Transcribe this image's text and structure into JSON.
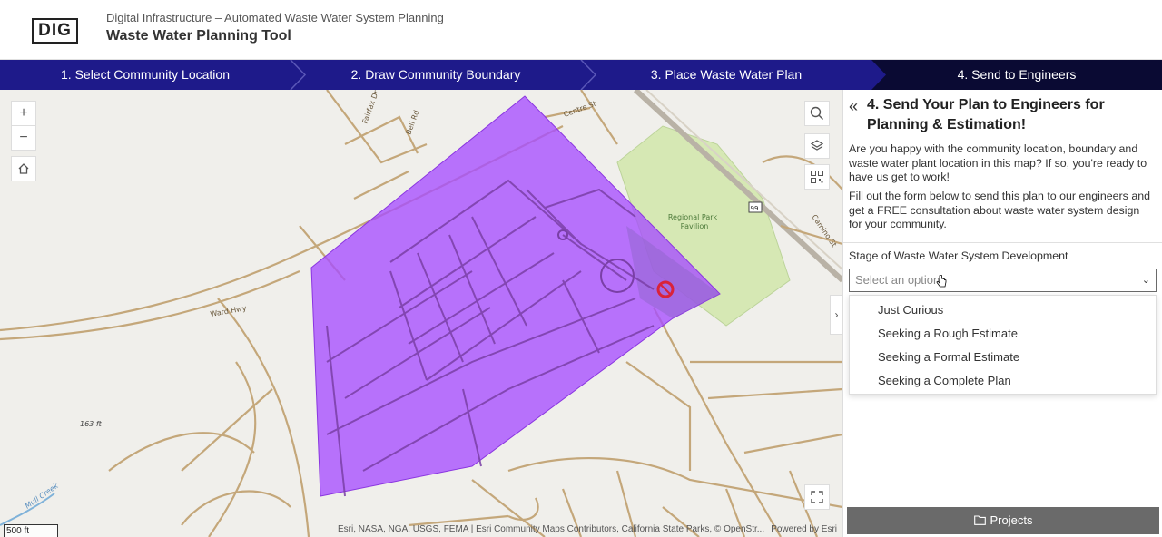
{
  "header": {
    "logo": "DIG",
    "subtitle": "Digital Infrastructure – Automated Waste Water System Planning",
    "title": "Waste Water Planning Tool"
  },
  "steps": [
    {
      "label": "1. Select Community Location",
      "active": false
    },
    {
      "label": "2. Draw Community Boundary",
      "active": false
    },
    {
      "label": "3. Place Waste Water Plan",
      "active": false
    },
    {
      "label": "4. Send to Engineers",
      "active": true
    }
  ],
  "colors": {
    "stepper": "#1e1a8a",
    "stepper_active": "#0a0a33",
    "boundary_fill": "#a64dff",
    "road": "#c4a77a",
    "park": "#d6e8b4",
    "marker": "#d9233a",
    "button": "#6a6a6a"
  },
  "map": {
    "controls": {
      "zoom_in": "+",
      "zoom_out": "−",
      "home_icon": "home-icon",
      "search_icon": "search-icon",
      "layers_icon": "layers-icon",
      "qr_icon": "qr-code-icon",
      "fullscreen_icon": "fullscreen-icon"
    },
    "labels": {
      "park": "Regional Park",
      "pavilion": "Pavilion",
      "elevation": "163 ft",
      "creek": "Mull Creek",
      "route_shield": "99",
      "street_a": "Fairfax Dr",
      "street_b": "Bell Rd",
      "street_c": "Ward Hwy",
      "street_d": "Centre St",
      "street_e": "Camino St"
    },
    "scale": "500 ft",
    "attribution": "Esri, NASA, NGA, USGS, FEMA | Esri Community Maps Contributors, California State Parks, © OpenStr...",
    "powered_by": "Powered by Esri"
  },
  "panel": {
    "title": "4. Send Your Plan to Engineers for Planning & Estimation!",
    "para1": "Are you happy with the community location, boundary and waste water plant location in this map? If so, you're ready to have us get to work!",
    "para2": "Fill out the form below to send this plan to our engineers and get a FREE consultation about waste water system design for your community.",
    "field_label": "Stage of Waste Water System Development",
    "select_placeholder": "Select an option",
    "options": [
      "Just Curious",
      "Seeking a Rough Estimate",
      "Seeking a Formal Estimate",
      "Seeking a Complete Plan"
    ],
    "projects_button": "Projects"
  }
}
